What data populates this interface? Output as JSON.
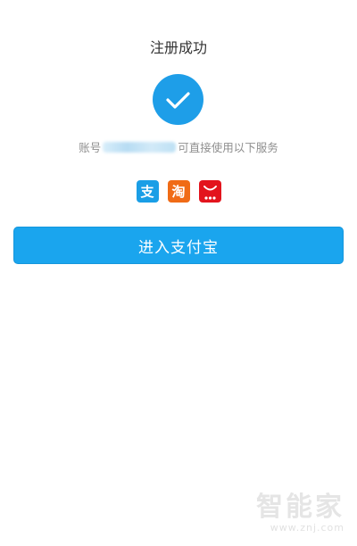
{
  "page": {
    "title": "注册成功",
    "account": {
      "prefix": "账号",
      "masked_value": "",
      "suffix": "可直接使用以下服务"
    },
    "services": [
      {
        "name": "alipay",
        "glyph": "支",
        "icon": "alipay-icon",
        "color": "#1a9ee6"
      },
      {
        "name": "taobao",
        "glyph": "淘",
        "icon": "taobao-icon",
        "color": "#f06b16"
      },
      {
        "name": "tmall",
        "glyph": "",
        "icon": "tmall-icon",
        "color": "#e3141d"
      }
    ],
    "enter_button_label": "进入支付宝"
  },
  "watermark": {
    "brand": "智能家",
    "url": "www.znj.com"
  },
  "colors": {
    "accent": "#1aa5ee",
    "check_circle": "#1e9ee8",
    "muted_text": "#8f8f8f"
  }
}
